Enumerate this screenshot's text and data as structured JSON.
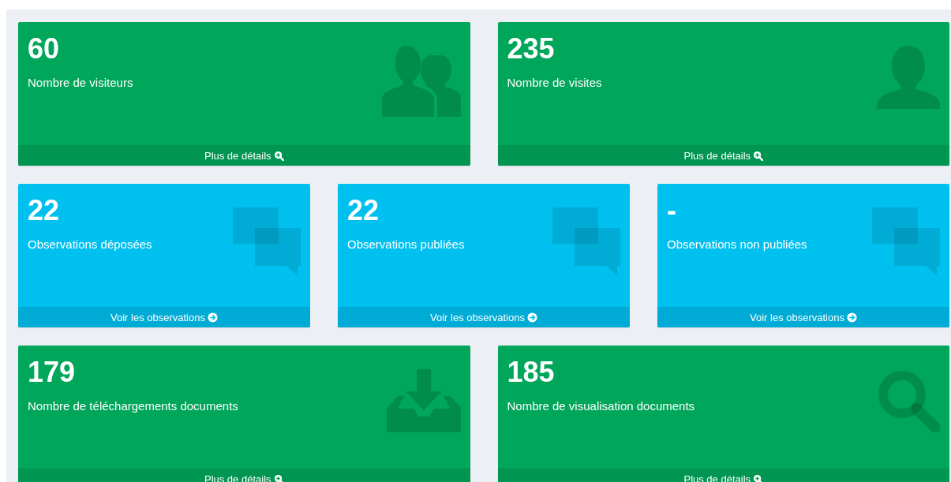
{
  "rows": [
    {
      "tiles": [
        {
          "kind": "visitors",
          "color": "#00a65a",
          "value": "60",
          "label": "Nombre de visiteurs",
          "link": "Plus de détails"
        },
        {
          "kind": "visits",
          "color": "#00a65a",
          "value": "235",
          "label": "Nombre de visites",
          "link": "Plus de détails"
        }
      ]
    },
    {
      "tiles": [
        {
          "kind": "observations",
          "color": "#00c0ef",
          "value": "22",
          "label": "Observations déposées",
          "link": "Voir les observations"
        },
        {
          "kind": "observations",
          "color": "#00c0ef",
          "value": "22",
          "label": "Observations publiées",
          "link": "Voir les observations"
        },
        {
          "kind": "observations",
          "color": "#00c0ef",
          "value": "-",
          "label": "Observations non publiées",
          "link": "Voir les observations"
        }
      ]
    },
    {
      "tiles": [
        {
          "kind": "downloads",
          "color": "#00a65a",
          "value": "179",
          "label": "Nombre de téléchargements documents",
          "link": "Plus de détails"
        },
        {
          "kind": "views",
          "color": "#00a65a",
          "value": "185",
          "label": "Nombre de visualisation documents",
          "link": "Plus de détails"
        }
      ]
    }
  ]
}
